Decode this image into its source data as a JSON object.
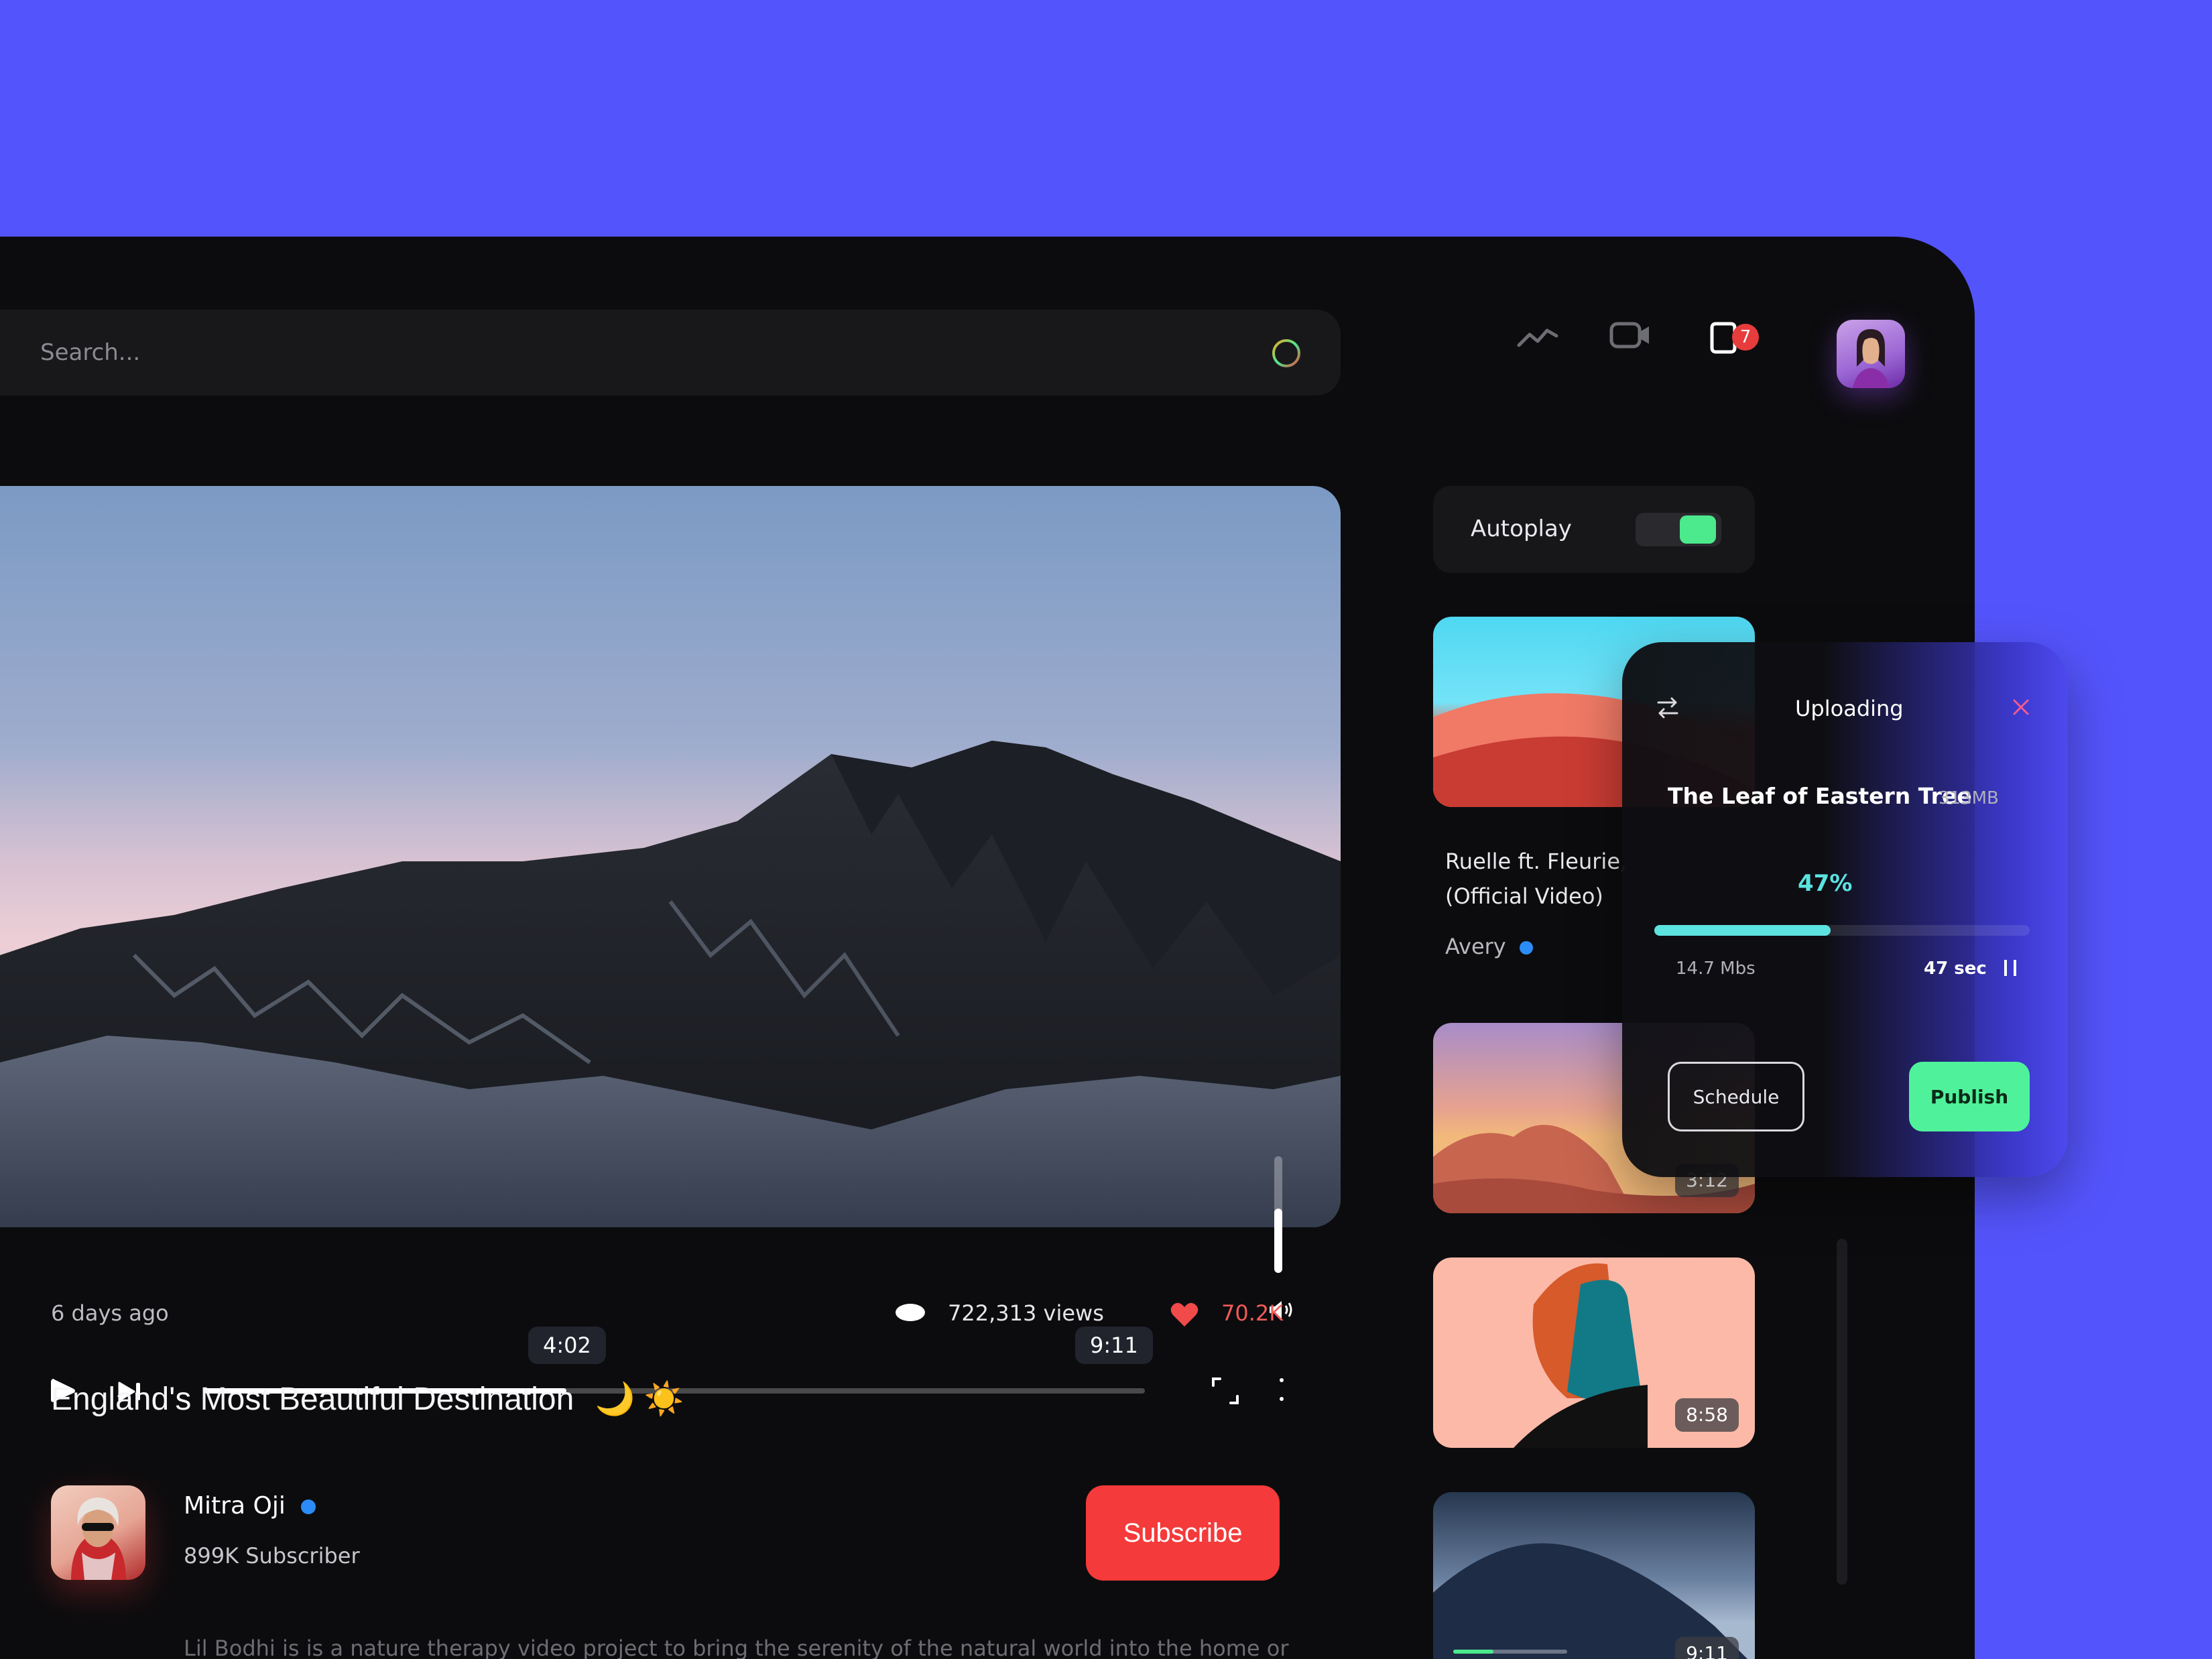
{
  "search": {
    "placeholder": "Search..."
  },
  "header": {
    "notification_count": "7"
  },
  "player": {
    "current_time": "4:02",
    "duration": "9:11",
    "progress_fraction": 0.385,
    "volume_fraction": 0.55
  },
  "video": {
    "posted": "6 days ago",
    "views": "722,313 views",
    "likes": "70.2K",
    "title": "England's Most Beautiful Destination",
    "title_emoji": "🌙 ☀️"
  },
  "channel": {
    "name": "Mitra Oji",
    "subscribers": "899K Subscriber",
    "subscribe_label": "Subscribe"
  },
  "description": "Lil Bodhi is is a nature therapy video project to bring the serenity of the natural world into the home or healing",
  "sidebar": {
    "autoplay_label": "Autoplay",
    "autoplay_on": true,
    "recommended": [
      {
        "title_line1": "Ruelle ft. Fleurie,",
        "title_line2": "(Official Video)",
        "author": "Avery"
      },
      {
        "duration": "3:12"
      },
      {
        "duration": "8:58"
      },
      {
        "duration": "9:11",
        "watched_fraction": 0.35
      }
    ]
  },
  "upload": {
    "title": "Uploading",
    "file_name": "The Leaf of Eastern Tree",
    "file_size": "313MB",
    "percent": "47%",
    "progress_fraction": 0.47,
    "speed": "14.7 Mbs",
    "remaining": "47 sec",
    "schedule_label": "Schedule",
    "publish_label": "Publish"
  },
  "colors": {
    "background": "#5454fd",
    "app": "#0c0c0e",
    "accent_green": "#4ce98d",
    "accent_red": "#f43a3a",
    "accent_cyan": "#5ce3e0"
  }
}
